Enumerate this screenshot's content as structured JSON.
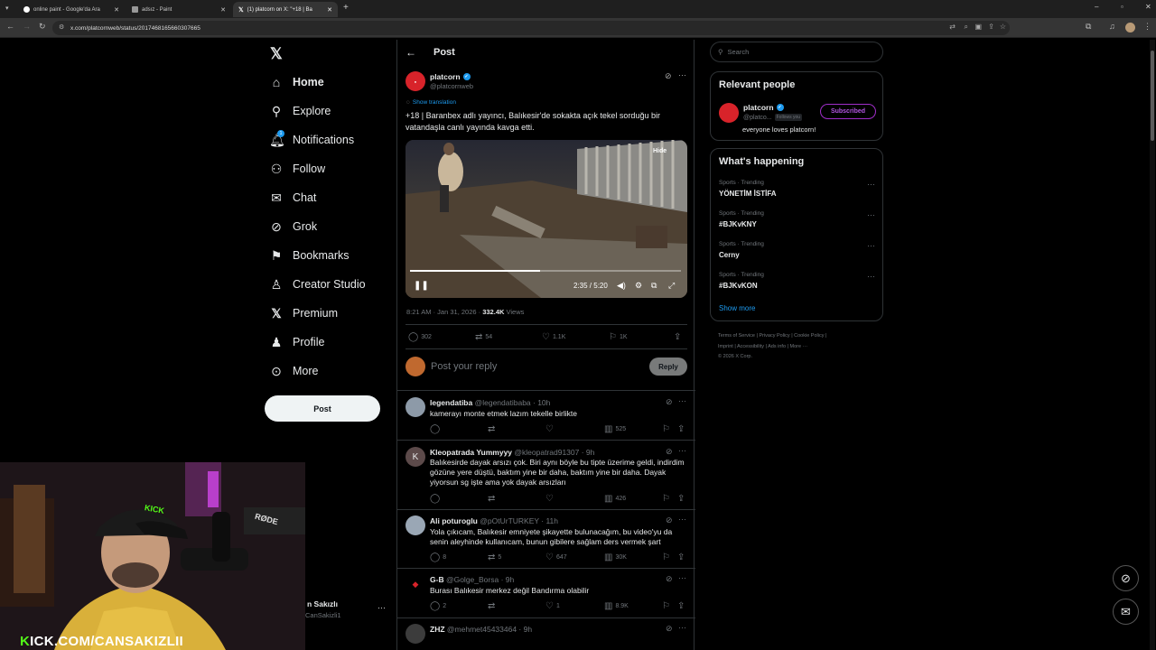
{
  "browser": {
    "tabs": [
      {
        "title": "online paint - Google'da Ara"
      },
      {
        "title": "adsız - Paint"
      },
      {
        "title": "(1) platcorn on X: \"+18 | Ba"
      }
    ],
    "url": "x.com/platcornweb/status/2017468165660307665"
  },
  "nav": {
    "items": [
      "Home",
      "Explore",
      "Notifications",
      "Follow",
      "Chat",
      "Grok",
      "Bookmarks",
      "Creator Studio",
      "Premium",
      "Profile",
      "More"
    ],
    "post_label": "Post",
    "notification_badge": "1"
  },
  "header": {
    "title": "Post"
  },
  "tweet": {
    "name": "platcorn",
    "handle": "@platcornweb",
    "show_translation": "Show translation",
    "text": "+18 | Baranbex adlı yayıncı, Balıkesir'de sokakta açık tekel sorduğu bir vatandaşla canlı yayında kavga etti.",
    "hide_label": "Hide",
    "video_time": "2:35 / 5:20",
    "video_progress": 0.48,
    "timestamp": "8:21 AM · Jan 31, 2026 · ",
    "views_count": "332.4K",
    "views_label": "Views",
    "stats": {
      "replies": "302",
      "reposts": "54",
      "likes": "1.1K",
      "bookmarks": "1K"
    }
  },
  "composer": {
    "placeholder": "Post your reply",
    "reply_label": "Reply"
  },
  "replies": [
    {
      "name": "legendatiba",
      "meta": "@legendatibaba · 10h",
      "text": "kamerayı monte etmek lazım tekelle birlikte",
      "replies": "",
      "reposts": "",
      "likes": "",
      "views": "525"
    },
    {
      "name": "Kleopatrada Yummyyy",
      "meta": "@kleopatrad91307 · 9h",
      "text": "Balıkesirde dayak arsızı çok. Biri aynı böyle bu tipte üzerime geldi, indirdim gözüne yere düştü, baktım yine bir daha, baktım yine bir daha. Dayak yiyorsun sg işte ama yok dayak arsızları",
      "avatar_letter": "K",
      "replies": "",
      "reposts": "",
      "likes": "",
      "views": "426"
    },
    {
      "name": "Ali poturoglu",
      "meta": "@pOtUrTURKEY · 11h",
      "text": "Yola çıkıcam, Balıkesir emniyete şikayette bulunacağım, bu video'yu da senin aleyhinde kullanıcam, bunun gibilere sağlam ders vermek şart",
      "replies": "8",
      "reposts": "5",
      "likes": "647",
      "views": "30K"
    },
    {
      "name": "G-B",
      "meta": "@Golge_Borsa · 9h",
      "text": "Burası Balıkesir merkez değil Bandırma olabilir",
      "replies": "2",
      "reposts": "",
      "likes": "1",
      "views": "8.9K"
    },
    {
      "name": "ZHZ",
      "meta": "@mehmet45433464 · 9h",
      "text": ""
    }
  ],
  "search": {
    "placeholder": "Search"
  },
  "relevant": {
    "title": "Relevant people",
    "name": "platcorn",
    "handle": "@platco...",
    "follows_you": "Follows you",
    "subscribed_label": "Subscribed",
    "bio": "everyone loves platcorn!"
  },
  "happening": {
    "title": "What's happening",
    "trends": [
      {
        "category": "Sports · Trending",
        "name": "YÖNETİM İSTİFA"
      },
      {
        "category": "Sports · Trending",
        "name": "#BJKvKNY"
      },
      {
        "category": "Sports · Trending",
        "name": "Cerny"
      },
      {
        "category": "Sports · Trending",
        "name": "#BJKvKON"
      }
    ],
    "show_more": "Show more"
  },
  "footer": {
    "line1": "Terms of Service  |  Privacy Policy  |  Cookie Policy  |",
    "line2": "Imprint  |  Accessibility  |  Ads info  |  More ···",
    "line3": "© 2026 X Corp."
  },
  "account": {
    "name": "n Sakızlı",
    "handle": "CanSakizli1"
  },
  "overlay": {
    "kick_brand": "K",
    "kick_text": "ICK.COM/CANSAKIZLII",
    "cap_text": "KICK",
    "mic_text": "RØDE"
  }
}
